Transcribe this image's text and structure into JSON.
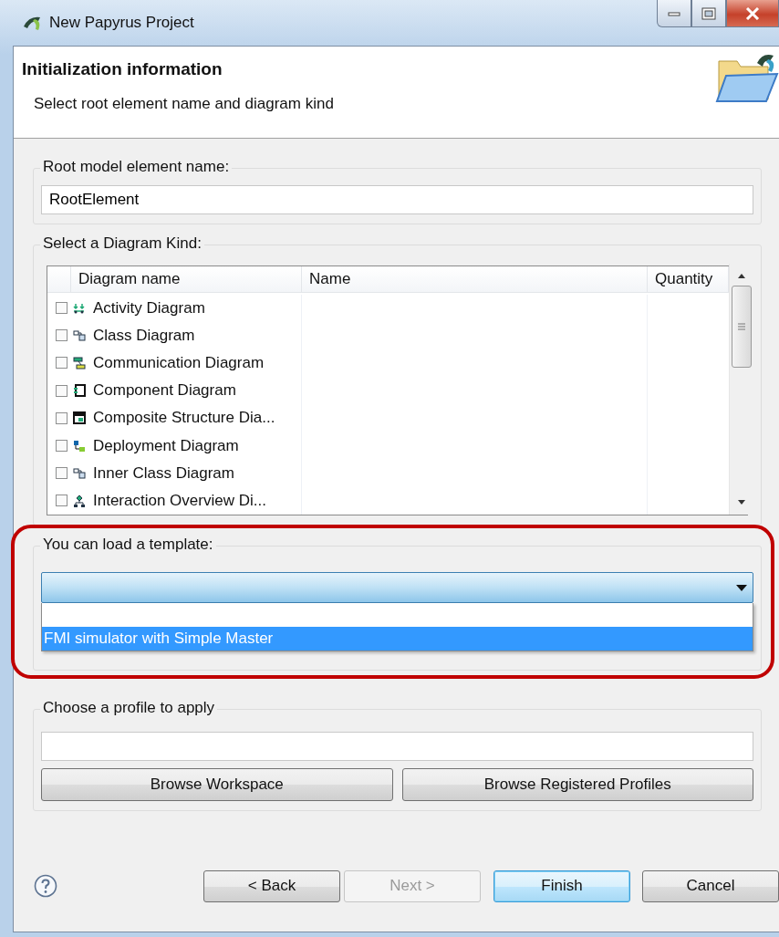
{
  "window": {
    "title": "New Papyrus Project"
  },
  "header": {
    "title": "Initialization information",
    "subtitle": "Select root element name and diagram kind"
  },
  "root_group": {
    "label": "Root model element name:",
    "value": "RootElement"
  },
  "diagram_group": {
    "label": "Select a Diagram Kind:",
    "columns": [
      "Diagram name",
      "Name",
      "Quantity"
    ],
    "rows": [
      {
        "name": "Activity Diagram",
        "checked": false
      },
      {
        "name": "Class Diagram",
        "checked": false
      },
      {
        "name": "Communication Diagram",
        "checked": false
      },
      {
        "name": "Component Diagram",
        "checked": false
      },
      {
        "name": "Composite Structure Dia...",
        "checked": false
      },
      {
        "name": "Deployment Diagram",
        "checked": false
      },
      {
        "name": "Inner Class Diagram",
        "checked": false
      },
      {
        "name": "Interaction Overview Di...",
        "checked": false
      }
    ]
  },
  "template_group": {
    "label": "You can load a template:",
    "expanded": true,
    "highlighted": true,
    "options": [
      {
        "label": "FMI simulator with Simple Master",
        "selected": true
      }
    ]
  },
  "profile_group": {
    "label": "Choose a profile to apply",
    "buttons": [
      "Browse Workspace",
      "Browse Registered Profiles"
    ]
  },
  "buttons": [
    {
      "label": "< Back",
      "disabled": false,
      "default": false
    },
    {
      "label": "Next >",
      "disabled": true,
      "default": false
    },
    {
      "label": "Finish",
      "disabled": false,
      "default": true
    },
    {
      "label": "Cancel",
      "disabled": false,
      "default": false
    }
  ]
}
